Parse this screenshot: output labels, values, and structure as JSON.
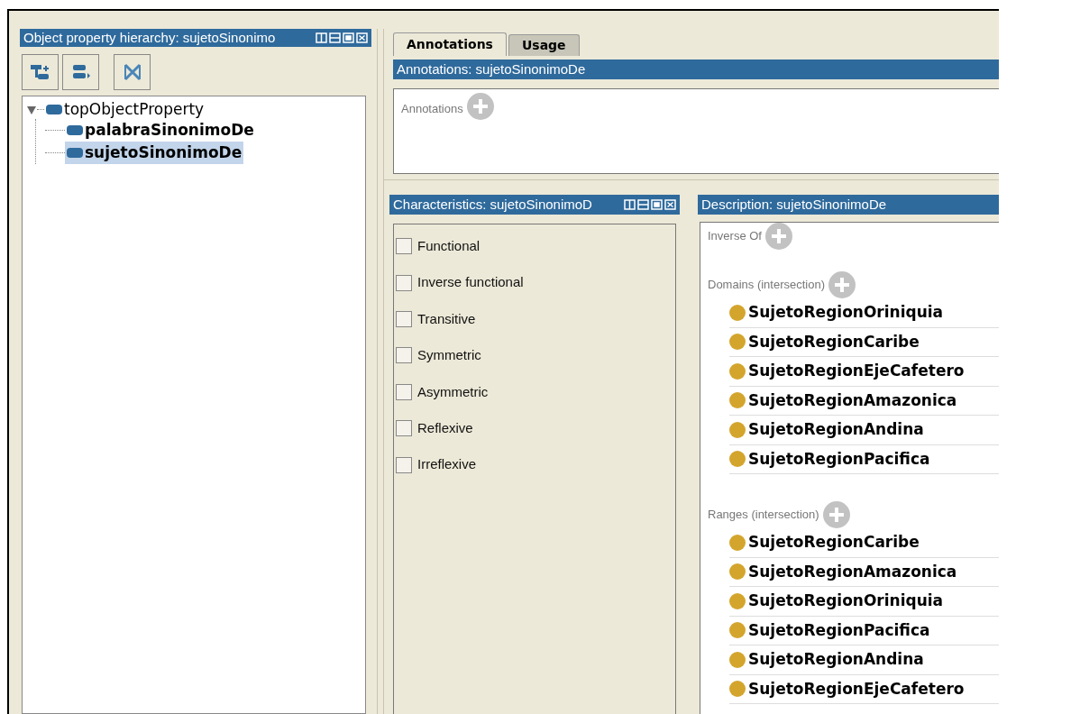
{
  "hierarchy": {
    "title": "Object property hierarchy: sujetoSinonimo",
    "tree": [
      {
        "label": "topObjectProperty",
        "expanded": true,
        "selected": false,
        "children": [
          {
            "label": "palabraSinonimoDe",
            "selected": false
          },
          {
            "label": "sujetoSinonimoDe",
            "selected": true
          }
        ]
      }
    ]
  },
  "tabs": [
    {
      "label": "Annotations",
      "selected": true
    },
    {
      "label": "Usage",
      "selected": false
    }
  ],
  "annotations": {
    "title": "Annotations: sujetoSinonimoDe",
    "section": "Annotations"
  },
  "characteristics": {
    "title": "Characteristics: sujetoSinonimoD",
    "items": [
      {
        "label": "Functional",
        "checked": false
      },
      {
        "label": "Inverse functional",
        "checked": false
      },
      {
        "label": "Transitive",
        "checked": false
      },
      {
        "label": "Symmetric",
        "checked": false
      },
      {
        "label": "Asymmetric",
        "checked": false
      },
      {
        "label": "Reflexive",
        "checked": false
      },
      {
        "label": "Irreflexive",
        "checked": false
      }
    ]
  },
  "description": {
    "title": "Description: sujetoSinonimoDe",
    "sections": [
      {
        "label": "Inverse Of"
      },
      {
        "label": "Domains (intersection)",
        "items": [
          "SujetoRegionOriniquia",
          "SujetoRegionCaribe",
          "SujetoRegionEjeCafetero",
          "SujetoRegionAmazonica",
          "SujetoRegionAndina",
          "SujetoRegionPacifica"
        ]
      },
      {
        "label": "Ranges (intersection)",
        "items": [
          "SujetoRegionCaribe",
          "SujetoRegionAmazonica",
          "SujetoRegionOriniquia",
          "SujetoRegionPacifica",
          "SujetoRegionAndina",
          "SujetoRegionEjeCafetero"
        ]
      }
    ]
  }
}
